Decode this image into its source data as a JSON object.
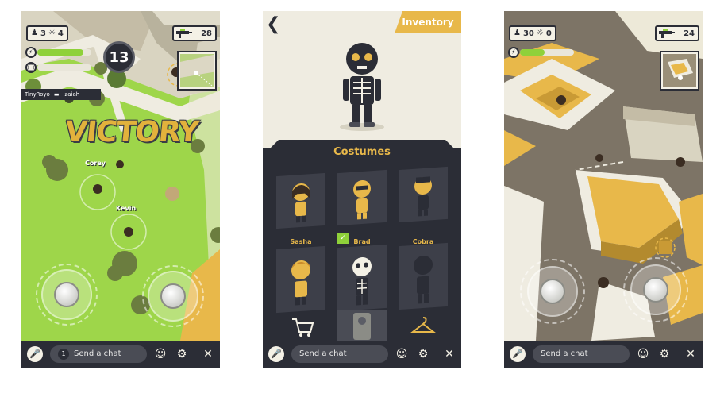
{
  "screens": [
    {
      "hud": {
        "players": "3",
        "kills": "4",
        "ammo": "28",
        "alive": "13"
      },
      "killfeed": {
        "killer": "TinyRoyo",
        "victim": "Izaiah"
      },
      "banner": "VICTORY",
      "players": [
        "Corey",
        "Kevin"
      ],
      "chat": {
        "badge": "1",
        "placeholder": "Send a chat"
      },
      "health": 0.85
    },
    {
      "tab": "Inventory",
      "section_title": "Costumes",
      "costumes": [
        {
          "label": "",
          "selected": false
        },
        {
          "label": "",
          "selected": false
        },
        {
          "label": "",
          "selected": false
        },
        {
          "label": "Sasha",
          "selected": false
        },
        {
          "label": "Brad",
          "selected": true
        },
        {
          "label": "Cobra",
          "selected": false
        }
      ],
      "bottom_tabs": [
        "cart-icon",
        "costume-icon",
        "hanger-icon"
      ],
      "chat": {
        "placeholder": "Send a chat"
      }
    },
    {
      "hud": {
        "players": "30",
        "kills": "0",
        "ammo": "24"
      },
      "chat": {
        "placeholder": "Send a chat"
      },
      "health": 0.45
    }
  ],
  "colors": {
    "grass": "#9ed64a",
    "sand": "#e8b84a",
    "dark": "#2b2d36",
    "cream": "#f4f1e6",
    "health": "#8fd13a"
  }
}
